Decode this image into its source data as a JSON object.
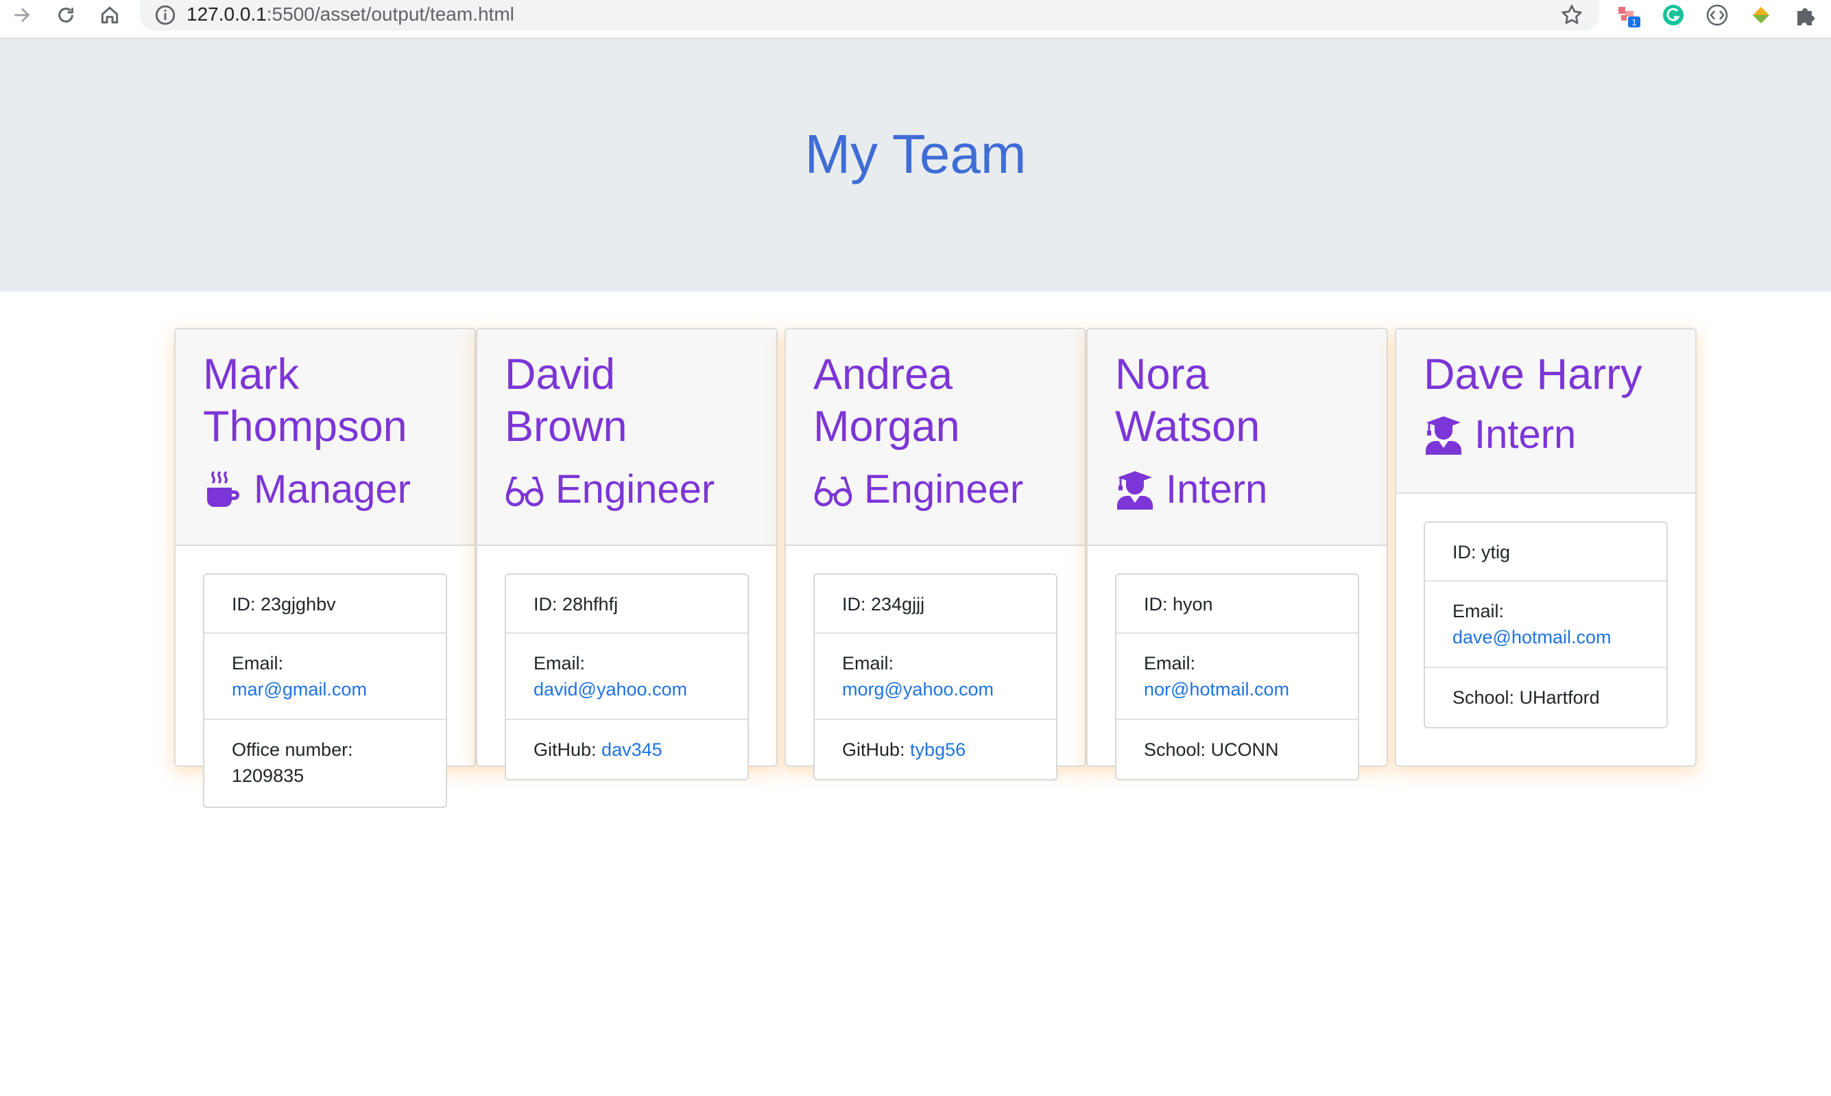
{
  "browser": {
    "url_host": "127.0.0.1",
    "url_rest": ":5500/asset/output/team.html",
    "extension_badge": "1"
  },
  "page": {
    "title": "My Team"
  },
  "employees": [
    {
      "name": "Mark Thompson",
      "role": "Manager",
      "role_icon": "coffee-mug-icon",
      "id_text": "ID: 23gjghbv",
      "email_label": "Email:",
      "email": "mar@gmail.com",
      "extra_label": "Office number:",
      "extra_value": "1209835"
    },
    {
      "name": "David Brown",
      "role": "Engineer",
      "role_icon": "glasses-icon",
      "id_text": "ID: 28hfhfj",
      "email_label": "Email:",
      "email": "david@yahoo.com",
      "extra_label": "GitHub:",
      "extra_value": "dav345"
    },
    {
      "name": "Andrea Morgan",
      "role": "Engineer",
      "role_icon": "glasses-icon",
      "id_text": "ID: 234gjjj",
      "email_label": "Email:",
      "email": "morg@yahoo.com",
      "extra_label": "GitHub:",
      "extra_value": "tybg56"
    },
    {
      "name": "Nora Watson",
      "role": "Intern",
      "role_icon": "graduate-icon",
      "id_text": "ID: hyon",
      "email_label": "Email:",
      "email": "nor@hotmail.com",
      "extra_label": "School:",
      "extra_value": "UCONN"
    },
    {
      "name": "Dave Harry",
      "role": "Intern",
      "role_icon": "graduate-icon",
      "id_text": "ID: ytig",
      "email_label": "Email:",
      "email": "dave@hotmail.com",
      "extra_label": "School:",
      "extra_value": "UHartford"
    }
  ],
  "colors": {
    "accent": "#7c35d6",
    "title": "#3f6dd6",
    "link": "#1f73e0",
    "jumbotron": "#e9ecef"
  }
}
